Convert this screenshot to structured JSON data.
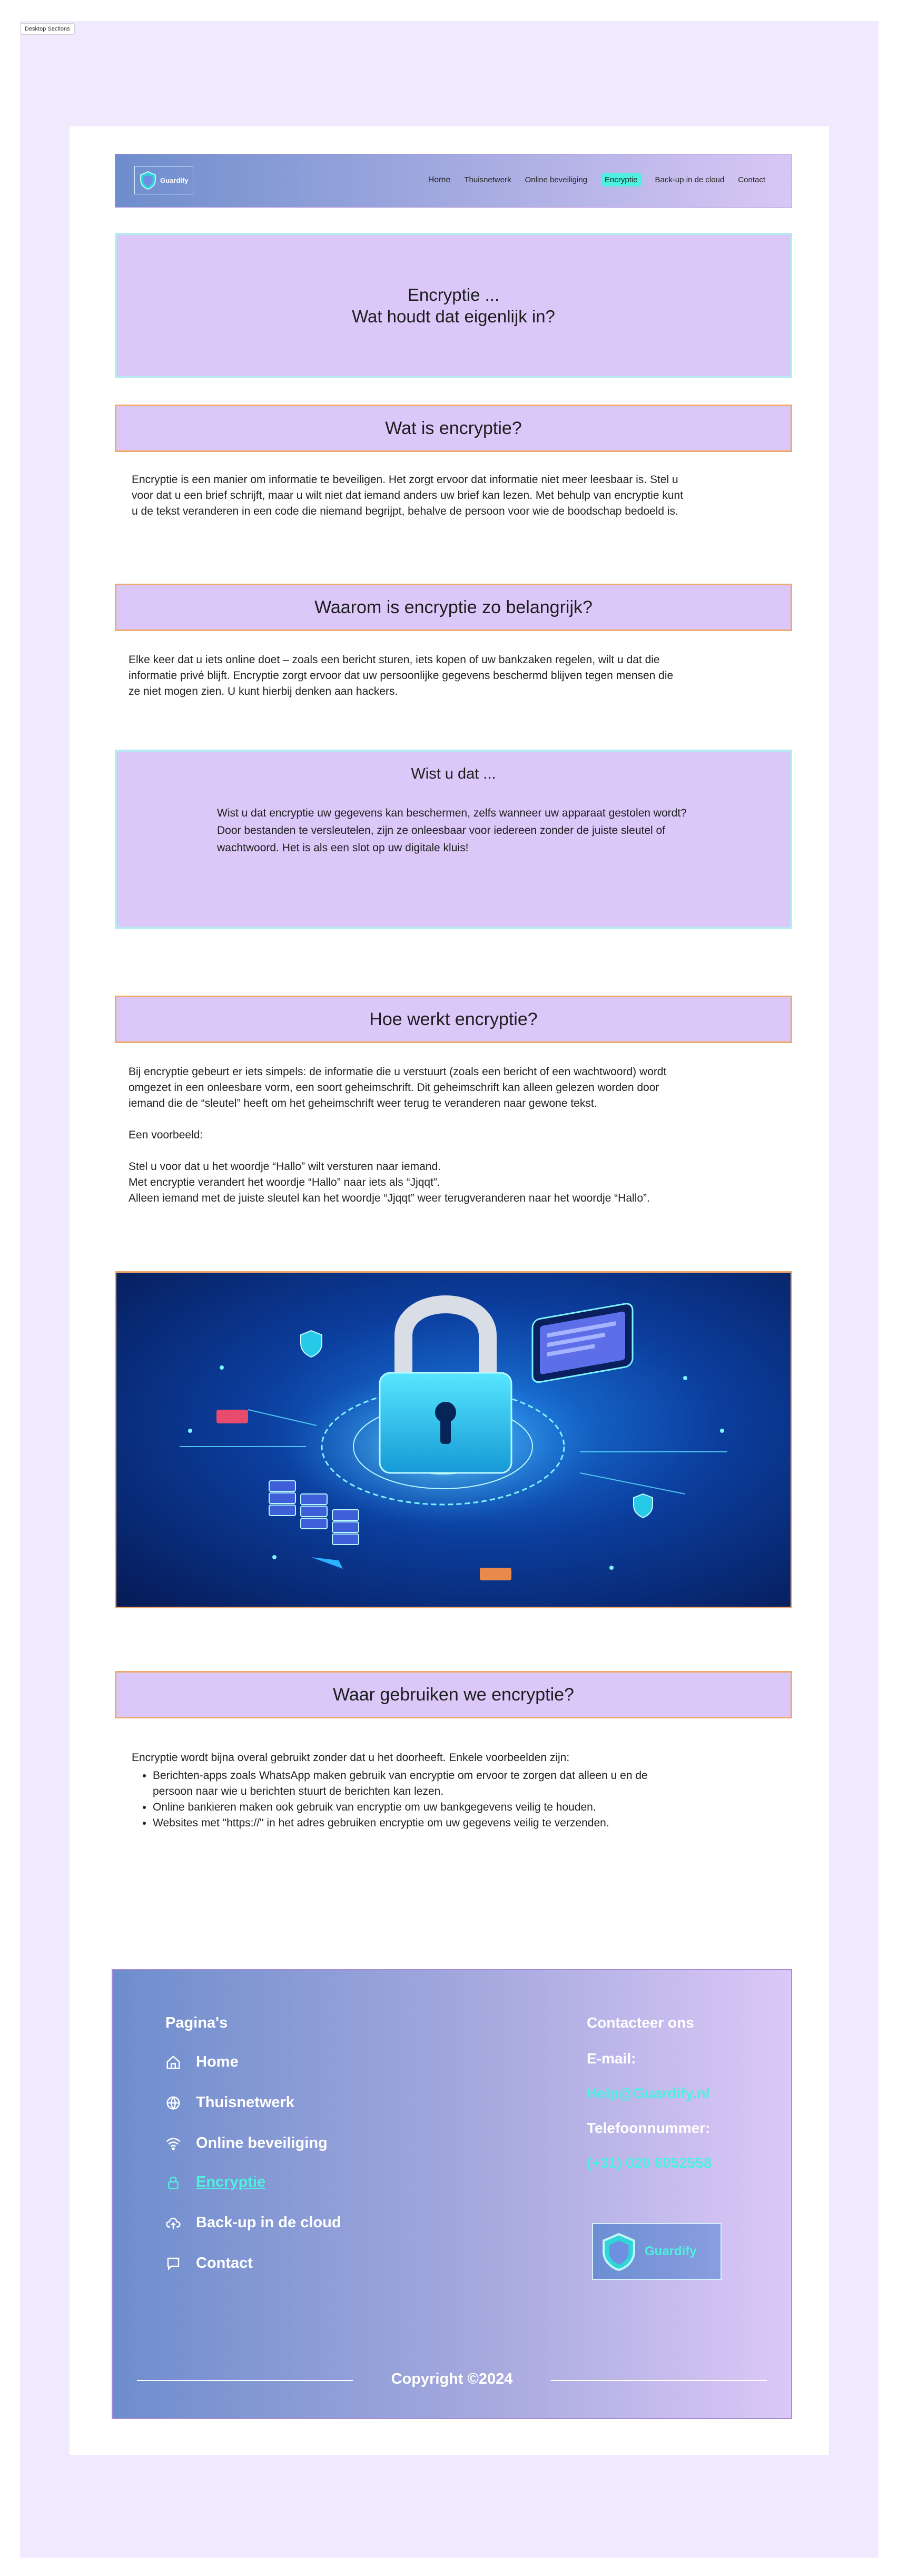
{
  "canvas_label": "Desktop Sections",
  "nav": {
    "logo_text": "Guardify",
    "links": [
      "Home",
      "Thuisnetwerk",
      "Online beveiliging",
      "Encryptie",
      "Back-up in de cloud",
      "Contact"
    ]
  },
  "hero": {
    "line1": "Encryptie ...",
    "line2": "Wat houdt dat eigenlijk in?"
  },
  "sections": {
    "what": {
      "title": "Wat is encryptie?",
      "text": "Encryptie is een manier om informatie te beveiligen. Het zorgt ervoor dat informatie niet meer leesbaar is. Stel u  voor dat u een brief schrijft, maar u wilt niet dat iemand anders uw brief kan lezen. Met behulp van encryptie kunt u de tekst veranderen in een code die niemand begrijpt, behalve de persoon voor wie de boodschap bedoeld is."
    },
    "why": {
      "title": "Waarom is encryptie zo belangrijk?",
      "text": "Elke keer dat u iets online doet – zoals een bericht sturen, iets kopen of uw bankzaken regelen, wilt u dat die informatie privé blijft. Encryptie zorgt ervoor dat uw persoonlijke gegevens beschermd blijven tegen mensen die ze niet mogen zien. U kunt hierbij denken aan hackers."
    },
    "callout": {
      "title": "Wist u dat ...",
      "text": "Wist u dat encryptie uw gegevens kan beschermen, zelfs wanneer uw apparaat gestolen wordt? Door bestanden te versleutelen, zijn ze onleesbaar voor iedereen zonder de juiste sleutel of wachtwoord. Het is als een slot op uw digitale kluis!"
    },
    "how": {
      "title": "Hoe werkt encryptie?",
      "p1": "Bij encryptie gebeurt er iets simpels: de informatie die u verstuurt (zoals een bericht of een wachtwoord) wordt omgezet in een onleesbare vorm, een soort geheimschrift. Dit geheimschrift kan alleen gelezen worden door iemand die de “sleutel” heeft om het geheimschrift weer terug te veranderen naar gewone tekst.",
      "p2": "Een voorbeeld:",
      "p3": "Stel u voor dat u het woordje “Hallo” wilt versturen naar iemand.",
      "p4": "Met encryptie verandert het woordje “Hallo” naar  iets als “Jjqqt”.",
      "p5": "Alleen iemand met de juiste sleutel kan het woordje “Jjqqt” weer terugveranderen naar het woordje “Hallo”."
    },
    "where": {
      "title": "Waar gebruiken we encryptie?",
      "intro": "Encryptie wordt bijna overal gebruikt zonder dat u het doorheeft. Enkele voorbeelden zijn:",
      "items": [
        "Berichten-apps zoals WhatsApp maken gebruik van encryptie om ervoor te zorgen dat alleen u en de persoon naar wie u berichten stuurt de berichten kan lezen.",
        "Online bankieren maken ook gebruik van encryptie om uw bankgegevens veilig te houden.",
        "Websites met \"https://\" in het adres gebruiken encryptie om uw gegevens veilig te verzenden."
      ]
    }
  },
  "footer": {
    "pages_title": "Pagina's",
    "links": [
      {
        "label": "Home",
        "icon": "home-icon"
      },
      {
        "label": "Thuisnetwerk",
        "icon": "globe-icon"
      },
      {
        "label": "Online beveiliging",
        "icon": "wifi-icon"
      },
      {
        "label": "Encryptie",
        "icon": "lock-icon"
      },
      {
        "label": "Back-up in de cloud",
        "icon": "cloud-upload-icon"
      },
      {
        "label": "Contact",
        "icon": "chat-icon"
      }
    ],
    "contact_title": "Contacteer ons",
    "email_label": "E-mail:",
    "email_value": "Help@Guardify.nl",
    "phone_label": "Telefoonnummer:",
    "phone_value": "(+31) 020 6052558",
    "logo_text": "Guardify",
    "copyright": "Copyright ©2024"
  },
  "colors": {
    "frame": "#f1e9fd",
    "lavender": "#dcc8f8",
    "accent_cyan": "#4ef0e0",
    "accent_orange": "#f0a96b",
    "footer_left": "#6e8dcd"
  }
}
